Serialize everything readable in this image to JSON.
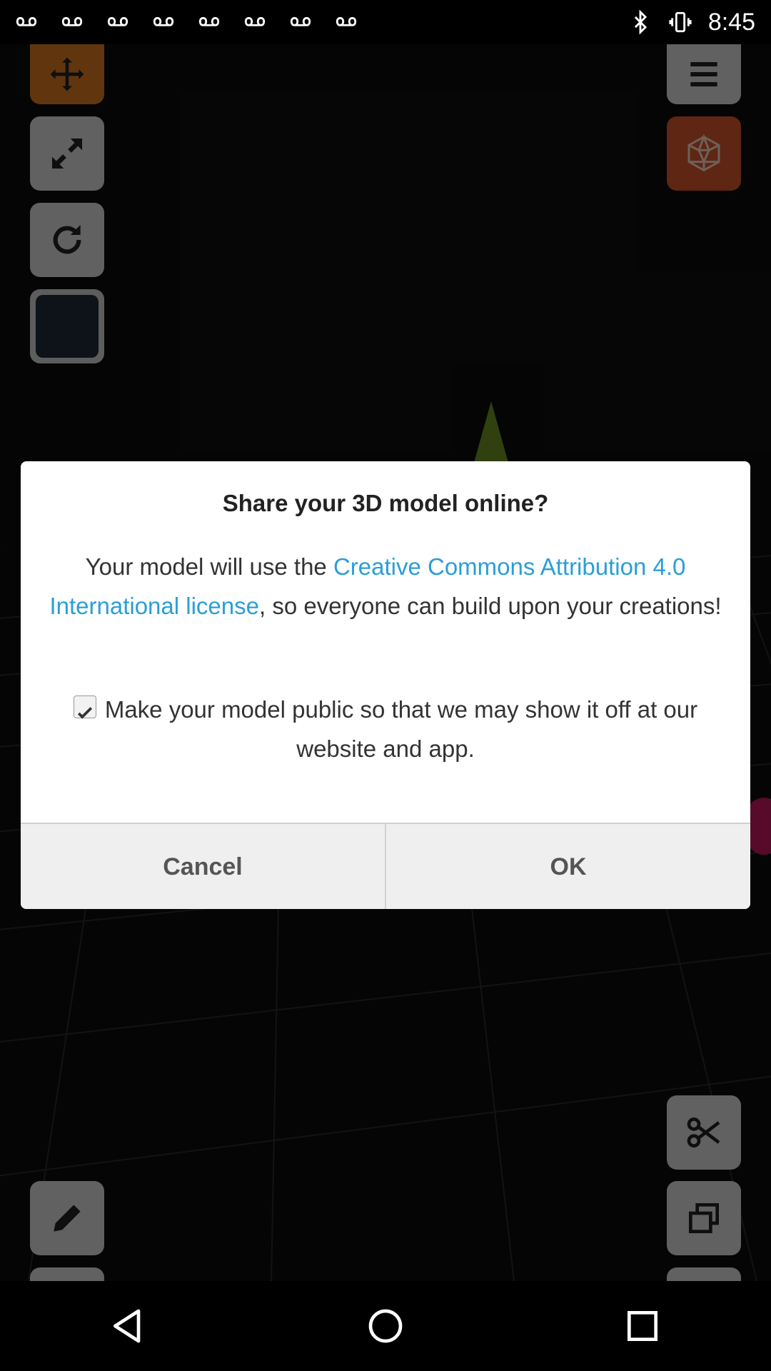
{
  "status_bar": {
    "time": "8:45",
    "notification_icons": [
      "voicemail-icon",
      "voicemail-icon",
      "voicemail-icon",
      "voicemail-icon",
      "voicemail-icon",
      "voicemail-icon",
      "voicemail-icon",
      "voicemail-icon"
    ],
    "right_icons": [
      "bluetooth-icon",
      "vibrate-icon"
    ]
  },
  "toolbar": {
    "left": [
      "move-icon",
      "resize-icon",
      "rotate-icon",
      "color-swatch"
    ],
    "right": [
      "menu-icon",
      "icosahedron-icon"
    ],
    "bottom_left": [
      "pencil-icon"
    ],
    "bottom_right": [
      "scissors-icon",
      "copy-icon"
    ]
  },
  "dialog": {
    "title": "Share your 3D model online?",
    "message_before": "Your model will use the ",
    "message_link": "Creative Commons Attribution 4.0 International license",
    "message_after": ", so everyone can build upon your creations!",
    "checkbox_label": "Make your model public so that we may show it off at our website and app.",
    "checkbox_checked": true,
    "cancel_label": "Cancel",
    "ok_label": "OK",
    "link_color": "#2a9fd6"
  },
  "navbar": {
    "buttons": [
      "back-icon",
      "home-icon",
      "recents-icon"
    ]
  }
}
